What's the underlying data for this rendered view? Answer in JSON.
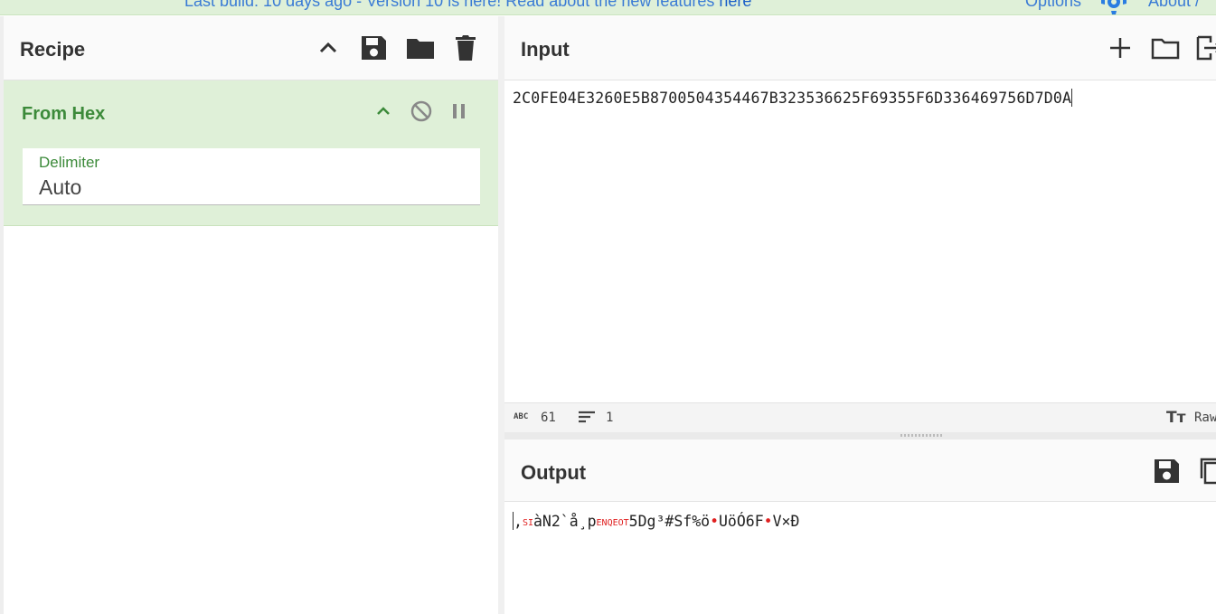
{
  "banner": {
    "prefix": "Last build: 10 days ago - Version 10 is here! Read about the new features ",
    "link": "here",
    "options": "Options",
    "about": "About / "
  },
  "recipe": {
    "title": "Recipe",
    "operation": {
      "name": "From Hex",
      "arg_label": "Delimiter",
      "arg_value": "Auto"
    }
  },
  "input": {
    "title": "Input",
    "text": "2C0FE04E3260E5B8700504354467B323536625F69355F6D336469756D7D0A",
    "status": {
      "length": "61",
      "lines": "1",
      "mode": "Raw"
    }
  },
  "output": {
    "title": "Output",
    "parts": [
      {
        "type": "text",
        "value": ","
      },
      {
        "type": "ctrl",
        "value": "SI"
      },
      {
        "type": "text",
        "value": "àN2`å"
      },
      {
        "type": "text",
        "value": "¸"
      },
      {
        "type": "text",
        "value": "p"
      },
      {
        "type": "ctrl",
        "value": "ENQEOT"
      },
      {
        "type": "text",
        "value": "5Dg³#Sf%ö"
      },
      {
        "type": "dot",
        "value": "•"
      },
      {
        "type": "text",
        "value": "UöÓ6F"
      },
      {
        "type": "dot",
        "value": "•"
      },
      {
        "type": "text",
        "value": "V×Ð"
      }
    ]
  },
  "icons": {
    "banner": [
      "gear-icon"
    ],
    "recipe_header": [
      "chevron-up-icon",
      "save-icon",
      "folder-icon",
      "trash-icon"
    ],
    "operation": [
      "chevron-up-icon",
      "disable-icon",
      "pause-icon"
    ],
    "input_header": [
      "plus-icon",
      "folder-icon",
      "exit-icon"
    ],
    "output_header": [
      "save-icon",
      "copy-icon"
    ],
    "status_bar": [
      "abc-icon",
      "lines-icon",
      "font-icon"
    ]
  },
  "colors": {
    "operation_bg": "#dff0d8",
    "operation_text": "#3c8a3a",
    "banner_link": "#3a7bd5",
    "control_char": "#e02020"
  }
}
